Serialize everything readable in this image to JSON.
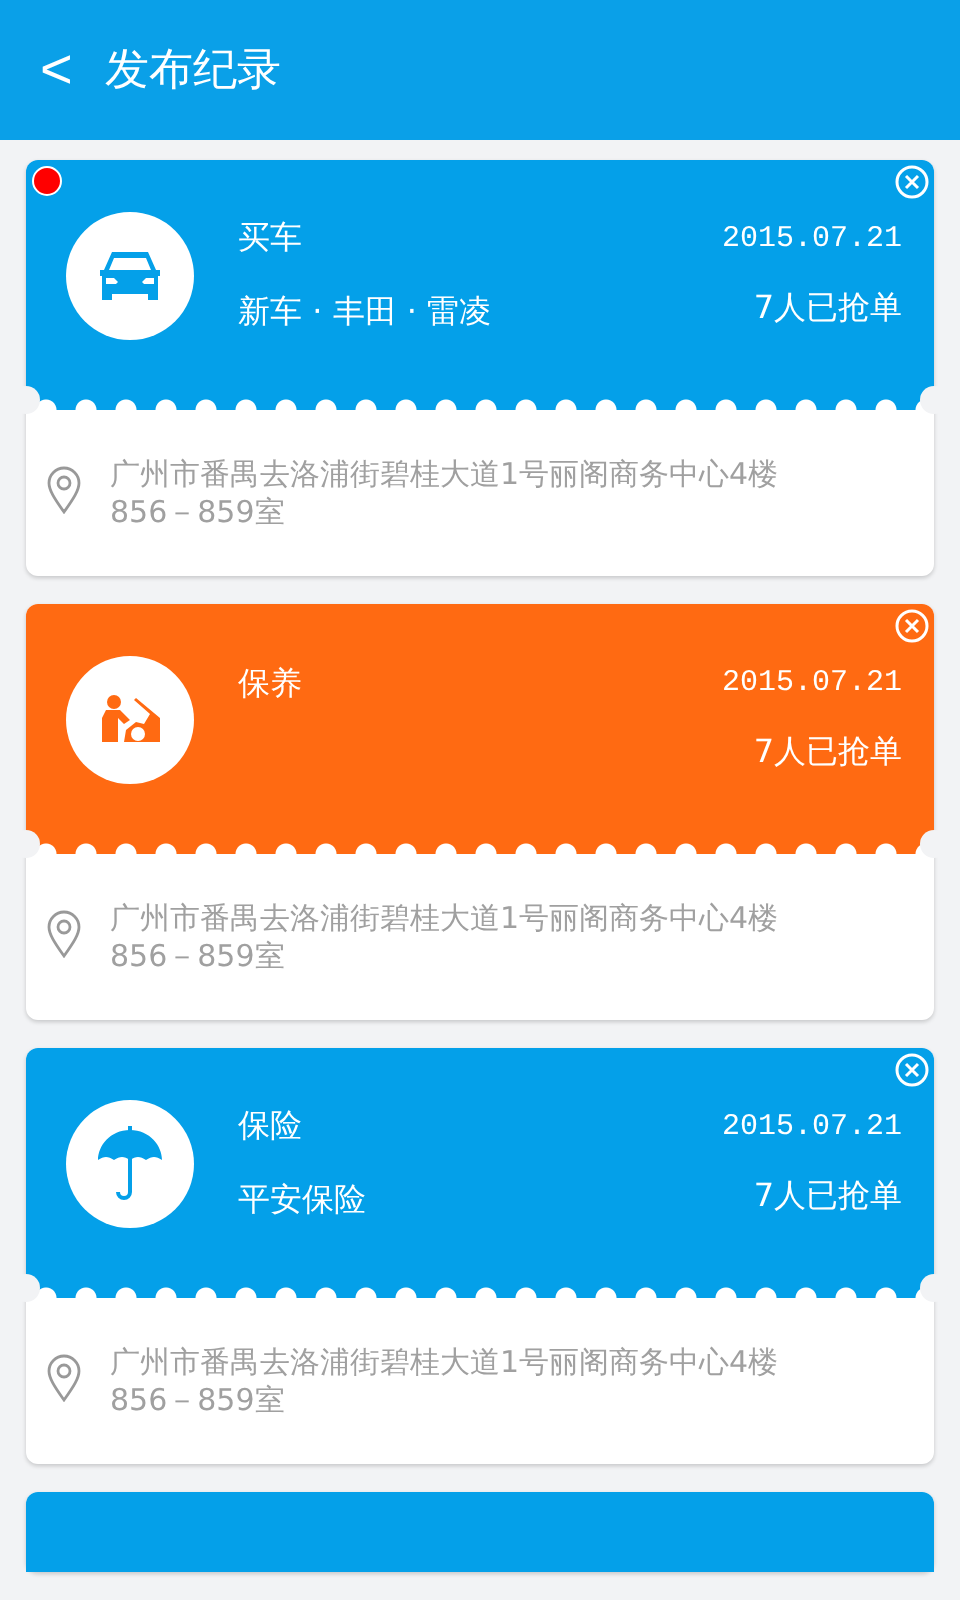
{
  "header": {
    "back": "<",
    "title": "发布纪录"
  },
  "records": [
    {
      "kind": "car",
      "color": "#04a0e9",
      "unread": true,
      "category": "买车",
      "detail": "新车 · 丰田 · 雷凌",
      "date": "2015.07.21",
      "grabbed": "7人已抢单",
      "address_lines": [
        "广州市番禺去洛浦街碧桂大道1号丽阁商务中心4楼",
        "856－859室"
      ]
    },
    {
      "kind": "repair",
      "color": "#ff6a12",
      "unread": false,
      "category": "保养",
      "date": "2015.07.21",
      "grabbed": "7人已抢单",
      "address_lines": [
        "广州市番禺去洛浦街碧桂大道1号丽阁商务中心4楼",
        "856－859室"
      ]
    },
    {
      "kind": "umbrella",
      "color": "#04a0e9",
      "unread": false,
      "category": "保险",
      "detail": "平安保险",
      "date": "2015.07.21",
      "grabbed": "7人已抢单",
      "address_lines": [
        "广州市番禺去洛浦街碧桂大道1号丽阁商务中心4楼",
        "856－859室"
      ]
    },
    {
      "kind": "peek",
      "color": "#04a0e9"
    }
  ]
}
